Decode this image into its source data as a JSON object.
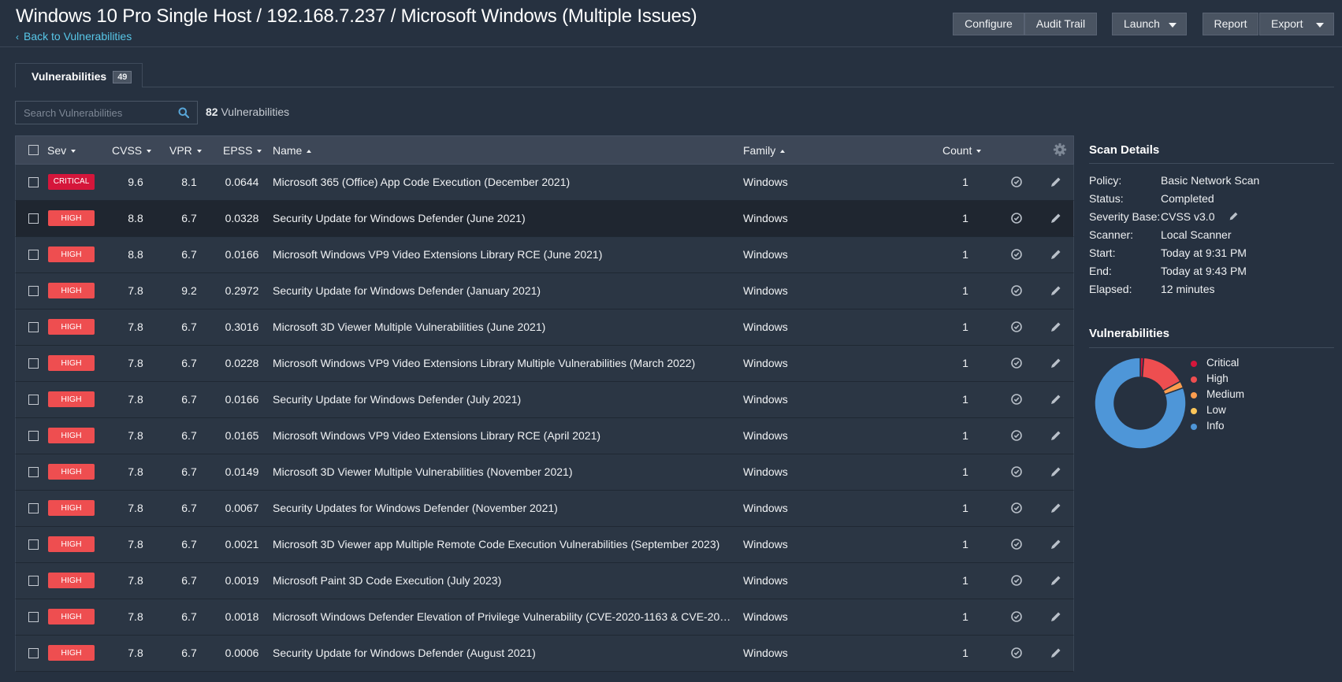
{
  "header": {
    "title": "Windows 10 Pro Single Host / 192.168.7.237 / Microsoft Windows (Multiple Issues)",
    "back_link": "Back to Vulnerabilities",
    "buttons": {
      "configure": "Configure",
      "audit_trail": "Audit Trail",
      "launch": "Launch",
      "report": "Report",
      "export": "Export"
    }
  },
  "tabs": {
    "vulnerabilities": {
      "label": "Vulnerabilities",
      "count": "49"
    }
  },
  "search": {
    "placeholder": "Search Vulnerabilities",
    "result_count": "82",
    "result_label": " Vulnerabilities"
  },
  "table": {
    "columns": {
      "sev": "Sev",
      "cvss": "CVSS",
      "vpr": "VPR",
      "epss": "EPSS",
      "name": "Name",
      "family": "Family",
      "count": "Count"
    },
    "rows": [
      {
        "sev": "CRITICAL",
        "cvss": "9.6",
        "vpr": "8.1",
        "epss": "0.0644",
        "name": "Microsoft 365 (Office) App Code Execution (December 2021)",
        "family": "Windows",
        "count": "1"
      },
      {
        "sev": "HIGH",
        "cvss": "8.8",
        "vpr": "6.7",
        "epss": "0.0328",
        "name": "Security Update for Windows Defender (June 2021)",
        "family": "Windows",
        "count": "1"
      },
      {
        "sev": "HIGH",
        "cvss": "8.8",
        "vpr": "6.7",
        "epss": "0.0166",
        "name": "Microsoft Windows VP9 Video Extensions Library RCE (June 2021)",
        "family": "Windows",
        "count": "1"
      },
      {
        "sev": "HIGH",
        "cvss": "7.8",
        "vpr": "9.2",
        "epss": "0.2972",
        "name": "Security Update for Windows Defender (January 2021)",
        "family": "Windows",
        "count": "1"
      },
      {
        "sev": "HIGH",
        "cvss": "7.8",
        "vpr": "6.7",
        "epss": "0.3016",
        "name": "Microsoft 3D Viewer Multiple Vulnerabilities (June 2021)",
        "family": "Windows",
        "count": "1"
      },
      {
        "sev": "HIGH",
        "cvss": "7.8",
        "vpr": "6.7",
        "epss": "0.0228",
        "name": "Microsoft Windows VP9 Video Extensions Library Multiple Vulnerabilities (March 2022)",
        "family": "Windows",
        "count": "1"
      },
      {
        "sev": "HIGH",
        "cvss": "7.8",
        "vpr": "6.7",
        "epss": "0.0166",
        "name": "Security Update for Windows Defender (July 2021)",
        "family": "Windows",
        "count": "1"
      },
      {
        "sev": "HIGH",
        "cvss": "7.8",
        "vpr": "6.7",
        "epss": "0.0165",
        "name": "Microsoft Windows VP9 Video Extensions Library RCE (April 2021)",
        "family": "Windows",
        "count": "1"
      },
      {
        "sev": "HIGH",
        "cvss": "7.8",
        "vpr": "6.7",
        "epss": "0.0149",
        "name": "Microsoft 3D Viewer Multiple Vulnerabilities (November 2021)",
        "family": "Windows",
        "count": "1"
      },
      {
        "sev": "HIGH",
        "cvss": "7.8",
        "vpr": "6.7",
        "epss": "0.0067",
        "name": "Security Updates for Windows Defender (November 2021)",
        "family": "Windows",
        "count": "1"
      },
      {
        "sev": "HIGH",
        "cvss": "7.8",
        "vpr": "6.7",
        "epss": "0.0021",
        "name": "Microsoft 3D Viewer app Multiple Remote Code Execution Vulnerabilities (September 2023)",
        "family": "Windows",
        "count": "1"
      },
      {
        "sev": "HIGH",
        "cvss": "7.8",
        "vpr": "6.7",
        "epss": "0.0019",
        "name": "Microsoft Paint 3D Code Execution (July 2023)",
        "family": "Windows",
        "count": "1"
      },
      {
        "sev": "HIGH",
        "cvss": "7.8",
        "vpr": "6.7",
        "epss": "0.0018",
        "name": "Microsoft Windows Defender Elevation of Privilege Vulnerability (CVE-2020-1163 & CVE-2020-1...",
        "family": "Windows",
        "count": "1"
      },
      {
        "sev": "HIGH",
        "cvss": "7.8",
        "vpr": "6.7",
        "epss": "0.0006",
        "name": "Security Update for Windows Defender (August 2021)",
        "family": "Windows",
        "count": "1"
      }
    ]
  },
  "scan_details": {
    "title": "Scan Details",
    "policy_label": "Policy:",
    "policy": "Basic Network Scan",
    "status_label": "Status:",
    "status": "Completed",
    "severity_base_label": "Severity Base:",
    "severity_base": "CVSS v3.0",
    "scanner_label": "Scanner:",
    "scanner": "Local Scanner",
    "start_label": "Start:",
    "start": "Today at 9:31 PM",
    "end_label": "End:",
    "end": "Today at 9:43 PM",
    "elapsed_label": "Elapsed:",
    "elapsed": "12 minutes"
  },
  "vulnerabilities_panel": {
    "title": "Vulnerabilities",
    "legend": [
      {
        "label": "Critical",
        "color": "#d5163b"
      },
      {
        "label": "High",
        "color": "#ee4e50"
      },
      {
        "label": "Medium",
        "color": "#fc9d4f"
      },
      {
        "label": "Low",
        "color": "#fdc65a"
      },
      {
        "label": "Info",
        "color": "#4e96d8"
      }
    ]
  },
  "chart_data": {
    "type": "pie",
    "categories": [
      "Critical",
      "High",
      "Medium",
      "Low",
      "Info"
    ],
    "values": [
      1,
      13,
      2,
      0,
      66
    ],
    "colors": [
      "#d5163b",
      "#ee4e50",
      "#fc9d4f",
      "#fdc65a",
      "#4e96d8"
    ]
  }
}
